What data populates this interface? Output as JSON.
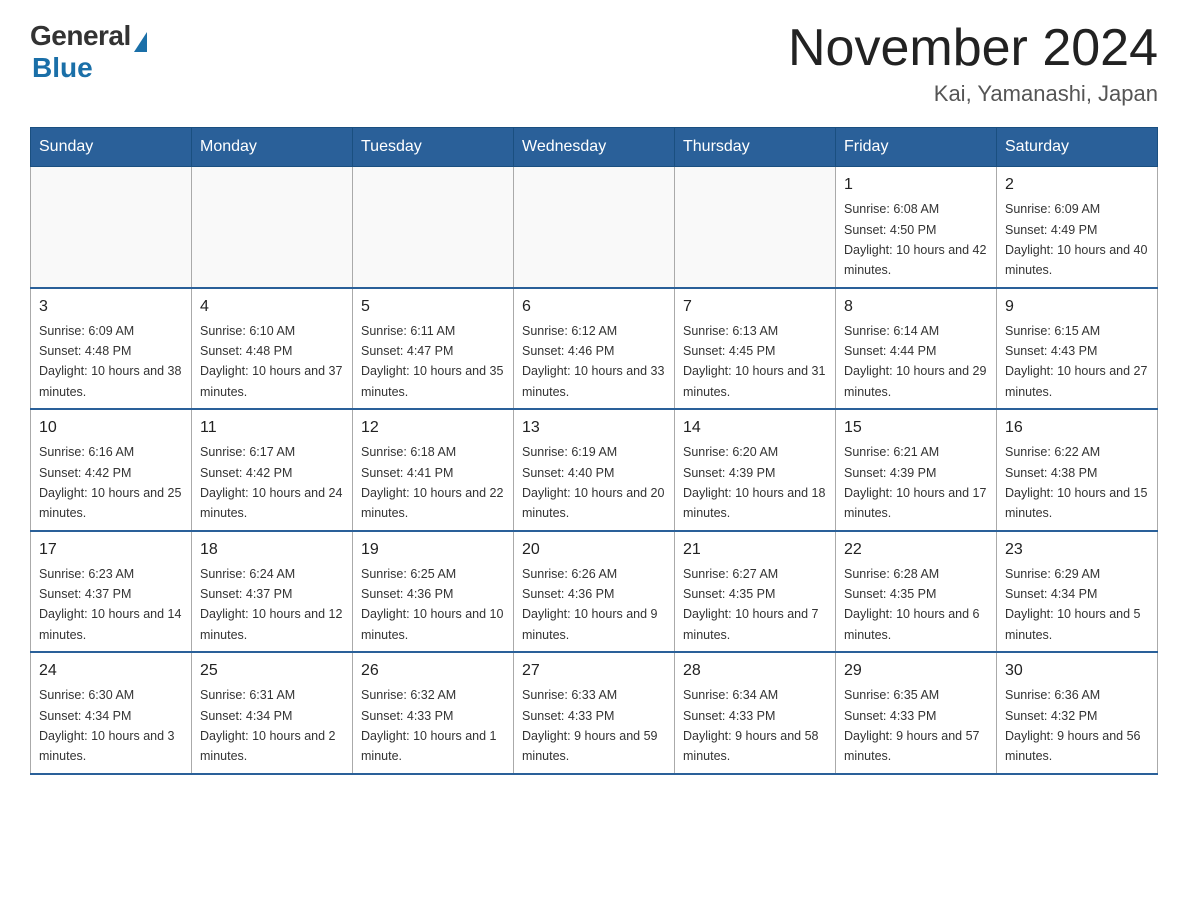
{
  "logo": {
    "general": "General",
    "blue": "Blue"
  },
  "title": "November 2024",
  "subtitle": "Kai, Yamanashi, Japan",
  "weekdays": [
    "Sunday",
    "Monday",
    "Tuesday",
    "Wednesday",
    "Thursday",
    "Friday",
    "Saturday"
  ],
  "weeks": [
    [
      {
        "day": "",
        "info": ""
      },
      {
        "day": "",
        "info": ""
      },
      {
        "day": "",
        "info": ""
      },
      {
        "day": "",
        "info": ""
      },
      {
        "day": "",
        "info": ""
      },
      {
        "day": "1",
        "info": "Sunrise: 6:08 AM\nSunset: 4:50 PM\nDaylight: 10 hours and 42 minutes."
      },
      {
        "day": "2",
        "info": "Sunrise: 6:09 AM\nSunset: 4:49 PM\nDaylight: 10 hours and 40 minutes."
      }
    ],
    [
      {
        "day": "3",
        "info": "Sunrise: 6:09 AM\nSunset: 4:48 PM\nDaylight: 10 hours and 38 minutes."
      },
      {
        "day": "4",
        "info": "Sunrise: 6:10 AM\nSunset: 4:48 PM\nDaylight: 10 hours and 37 minutes."
      },
      {
        "day": "5",
        "info": "Sunrise: 6:11 AM\nSunset: 4:47 PM\nDaylight: 10 hours and 35 minutes."
      },
      {
        "day": "6",
        "info": "Sunrise: 6:12 AM\nSunset: 4:46 PM\nDaylight: 10 hours and 33 minutes."
      },
      {
        "day": "7",
        "info": "Sunrise: 6:13 AM\nSunset: 4:45 PM\nDaylight: 10 hours and 31 minutes."
      },
      {
        "day": "8",
        "info": "Sunrise: 6:14 AM\nSunset: 4:44 PM\nDaylight: 10 hours and 29 minutes."
      },
      {
        "day": "9",
        "info": "Sunrise: 6:15 AM\nSunset: 4:43 PM\nDaylight: 10 hours and 27 minutes."
      }
    ],
    [
      {
        "day": "10",
        "info": "Sunrise: 6:16 AM\nSunset: 4:42 PM\nDaylight: 10 hours and 25 minutes."
      },
      {
        "day": "11",
        "info": "Sunrise: 6:17 AM\nSunset: 4:42 PM\nDaylight: 10 hours and 24 minutes."
      },
      {
        "day": "12",
        "info": "Sunrise: 6:18 AM\nSunset: 4:41 PM\nDaylight: 10 hours and 22 minutes."
      },
      {
        "day": "13",
        "info": "Sunrise: 6:19 AM\nSunset: 4:40 PM\nDaylight: 10 hours and 20 minutes."
      },
      {
        "day": "14",
        "info": "Sunrise: 6:20 AM\nSunset: 4:39 PM\nDaylight: 10 hours and 18 minutes."
      },
      {
        "day": "15",
        "info": "Sunrise: 6:21 AM\nSunset: 4:39 PM\nDaylight: 10 hours and 17 minutes."
      },
      {
        "day": "16",
        "info": "Sunrise: 6:22 AM\nSunset: 4:38 PM\nDaylight: 10 hours and 15 minutes."
      }
    ],
    [
      {
        "day": "17",
        "info": "Sunrise: 6:23 AM\nSunset: 4:37 PM\nDaylight: 10 hours and 14 minutes."
      },
      {
        "day": "18",
        "info": "Sunrise: 6:24 AM\nSunset: 4:37 PM\nDaylight: 10 hours and 12 minutes."
      },
      {
        "day": "19",
        "info": "Sunrise: 6:25 AM\nSunset: 4:36 PM\nDaylight: 10 hours and 10 minutes."
      },
      {
        "day": "20",
        "info": "Sunrise: 6:26 AM\nSunset: 4:36 PM\nDaylight: 10 hours and 9 minutes."
      },
      {
        "day": "21",
        "info": "Sunrise: 6:27 AM\nSunset: 4:35 PM\nDaylight: 10 hours and 7 minutes."
      },
      {
        "day": "22",
        "info": "Sunrise: 6:28 AM\nSunset: 4:35 PM\nDaylight: 10 hours and 6 minutes."
      },
      {
        "day": "23",
        "info": "Sunrise: 6:29 AM\nSunset: 4:34 PM\nDaylight: 10 hours and 5 minutes."
      }
    ],
    [
      {
        "day": "24",
        "info": "Sunrise: 6:30 AM\nSunset: 4:34 PM\nDaylight: 10 hours and 3 minutes."
      },
      {
        "day": "25",
        "info": "Sunrise: 6:31 AM\nSunset: 4:34 PM\nDaylight: 10 hours and 2 minutes."
      },
      {
        "day": "26",
        "info": "Sunrise: 6:32 AM\nSunset: 4:33 PM\nDaylight: 10 hours and 1 minute."
      },
      {
        "day": "27",
        "info": "Sunrise: 6:33 AM\nSunset: 4:33 PM\nDaylight: 9 hours and 59 minutes."
      },
      {
        "day": "28",
        "info": "Sunrise: 6:34 AM\nSunset: 4:33 PM\nDaylight: 9 hours and 58 minutes."
      },
      {
        "day": "29",
        "info": "Sunrise: 6:35 AM\nSunset: 4:33 PM\nDaylight: 9 hours and 57 minutes."
      },
      {
        "day": "30",
        "info": "Sunrise: 6:36 AM\nSunset: 4:32 PM\nDaylight: 9 hours and 56 minutes."
      }
    ]
  ]
}
